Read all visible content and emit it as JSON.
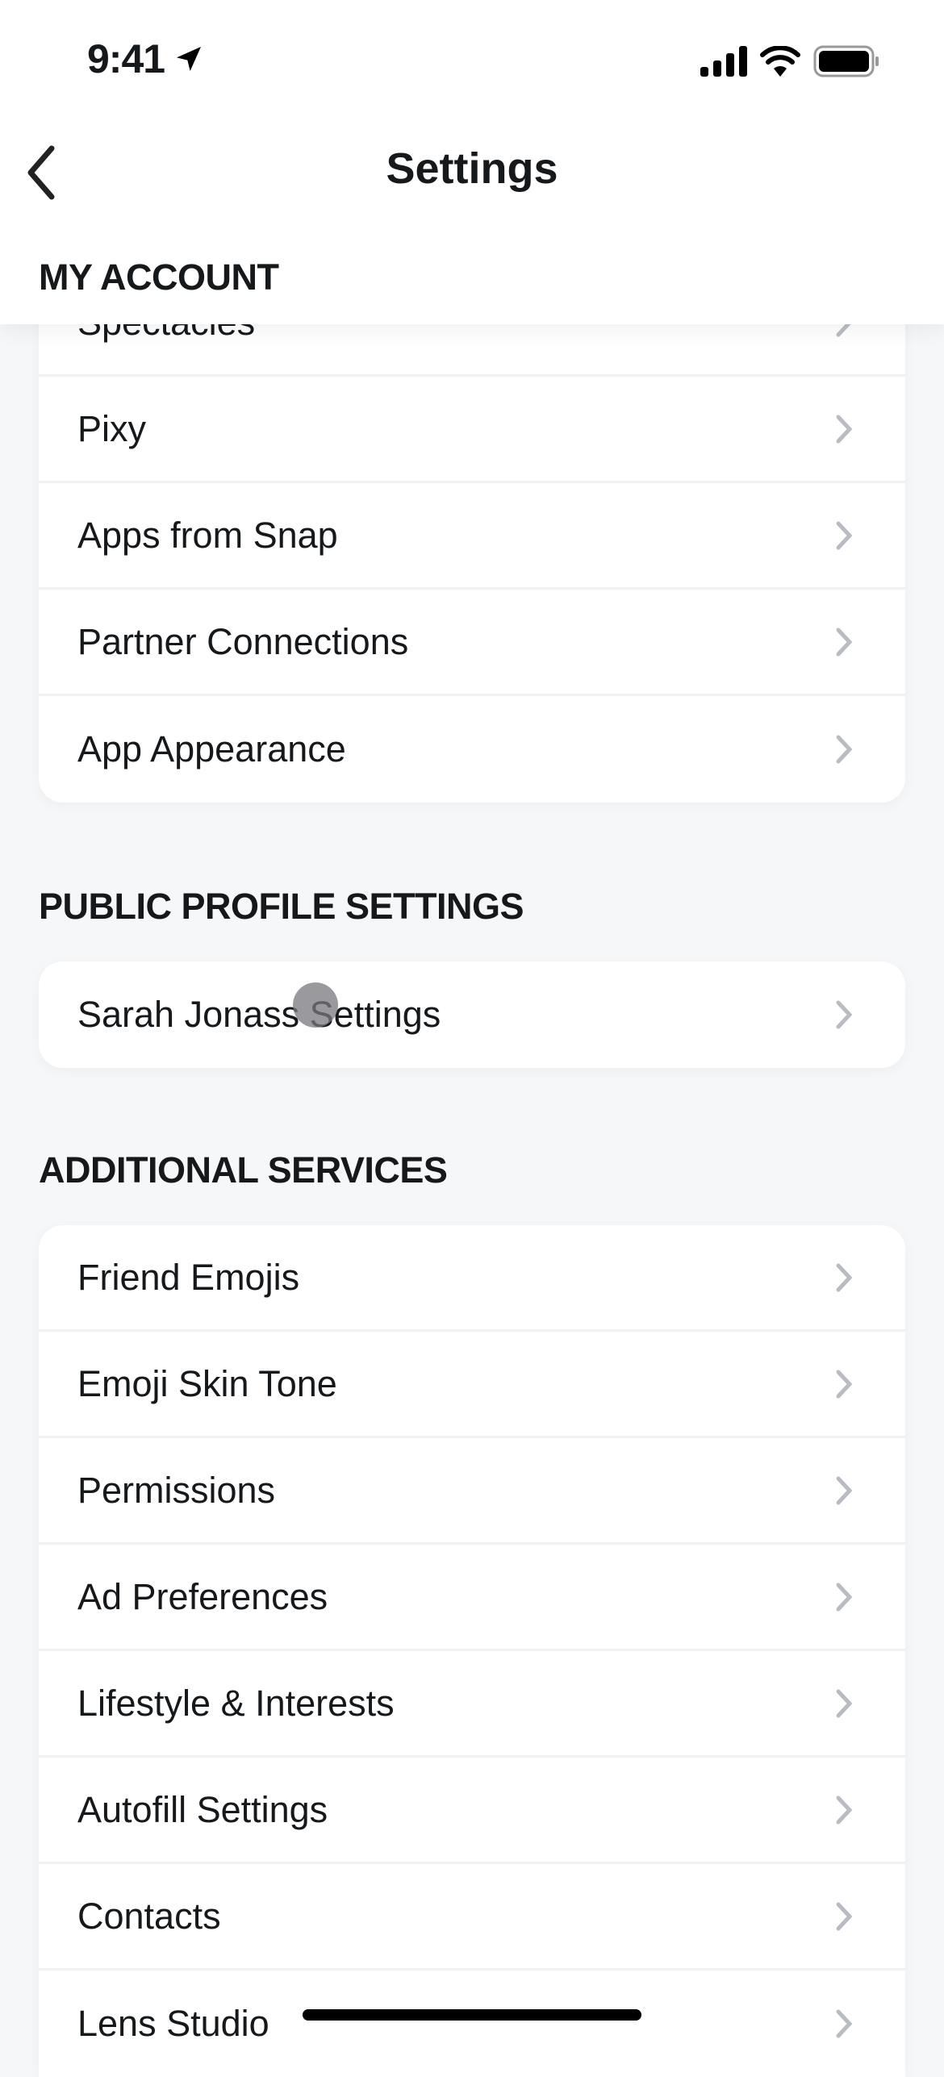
{
  "status_bar": {
    "time": "9:41",
    "icons": [
      "location-arrow-icon",
      "signal-icon",
      "wifi-icon",
      "battery-icon"
    ]
  },
  "header": {
    "title": "Settings",
    "back_icon": "chevron-left-icon"
  },
  "sections": [
    {
      "title": "MY ACCOUNT",
      "items": [
        "Spectacles",
        "Pixy",
        "Apps from Snap",
        "Partner Connections",
        "App Appearance"
      ]
    },
    {
      "title": "PUBLIC PROFILE SETTINGS",
      "items": [
        "Sarah Jonass Settings"
      ]
    },
    {
      "title": "ADDITIONAL SERVICES",
      "items": [
        "Friend Emojis",
        "Emoji Skin Tone",
        "Permissions",
        "Ad Preferences",
        "Lifestyle & Interests",
        "Autofill Settings",
        "Contacts",
        "Lens Studio"
      ]
    }
  ],
  "colors": {
    "background": "#f6f7f9",
    "card": "#ffffff",
    "chevron": "#b9bcc2",
    "text": "#16191c"
  }
}
